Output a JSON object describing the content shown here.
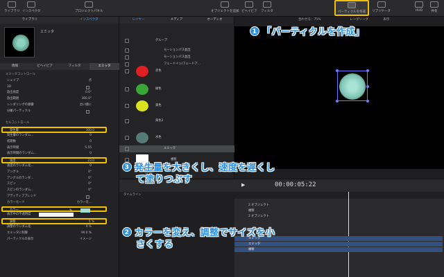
{
  "toolbar": {
    "library": "ライブラリ",
    "inspector": "インスペクタ",
    "project_panel": "プロジェクトパネル",
    "add_object": "オブジェクトを追加",
    "preview": "ビヘイビア",
    "filter": "フィルタ",
    "create_particles": "パーティクルを作成",
    "replicator": "リプリケータ",
    "hud": "HUD",
    "share": "共有"
  },
  "inspector": {
    "tabs": [
      "ライブラリ",
      "インスペクタ"
    ],
    "thumb_name": "エミッタ",
    "subtabs": [
      "情報",
      "ビヘイビア",
      "フィルタ",
      "エミッタ"
    ],
    "rows": [
      {
        "label": "エミッタコントロール",
        "type": "section"
      },
      {
        "label": "シェイプ",
        "value": "点"
      },
      {
        "label": "3D",
        "value": ""
      },
      {
        "label": "放出角度",
        "value": "0.0°"
      },
      {
        "label": "放出範囲",
        "value": "360.0°"
      },
      {
        "label": "レンダリングの順番",
        "value": "古い順に"
      },
      {
        "label": "分離パーティクル",
        "value": ""
      },
      {
        "label": "",
        "type": "spacer"
      },
      {
        "label": "セルコントロール",
        "type": "section"
      },
      {
        "label": "発生量",
        "value": "300.0",
        "hl": true
      },
      {
        "label": "発生量のランダム...",
        "value": "0"
      },
      {
        "label": "初期数",
        "value": "0"
      },
      {
        "label": "表示時間",
        "value": "5.55"
      },
      {
        "label": "表示時間のランダム...",
        "value": "0"
      },
      {
        "label": "速度",
        "value": "23.0",
        "hl": true
      },
      {
        "label": "速度のランダム化...",
        "value": "0"
      },
      {
        "label": "アングル",
        "value": "0°"
      },
      {
        "label": "アングルのランダ...",
        "value": "0°"
      },
      {
        "label": "スピン",
        "value": "0°"
      },
      {
        "label": "スピンのランダム...",
        "value": "0°"
      },
      {
        "label": "アディティブブレンド",
        "value": ""
      },
      {
        "label": "カラーモード",
        "value": "カラーを..."
      },
      {
        "label": "カラー",
        "value": "",
        "hl": true,
        "swatch": true
      },
      {
        "label": "表示中の不透明度",
        "value": "",
        "white": true
      },
      {
        "label": "調整",
        "value": "5 %",
        "hl": true
      },
      {
        "label": "調整のランダム化",
        "value": "0 %"
      },
      {
        "label": "エミッタに制御",
        "value": "90.0 %"
      },
      {
        "label": "パーティクルの表示",
        "value": "イメージ"
      }
    ]
  },
  "layers": {
    "tabs": [
      "レイヤー",
      "メディア",
      "オーディオ"
    ],
    "items": [
      {
        "name": "グループ"
      },
      {
        "name": "モーションパス並出"
      },
      {
        "name": "モーションパス並出"
      },
      {
        "name": "フェードイン/フェードア..."
      },
      {
        "name": "赤色"
      },
      {
        "name": "緑色"
      },
      {
        "name": "黄色"
      },
      {
        "name": "黄色2"
      },
      {
        "name": "水色"
      },
      {
        "name": "エミッタ"
      },
      {
        "name": "複製"
      }
    ]
  },
  "canvas": {
    "zoom_label": "合わせる：75%",
    "render": "レンダリング",
    "view": "表示",
    "timecode": "00:00:05:22"
  },
  "timeline": {
    "header": "タイムライン",
    "tracks": [
      {
        "label": "2 オブジェクト",
        "style": "dark"
      },
      {
        "label": "複製",
        "style": "dark"
      },
      {
        "label": "2 オブジェクト",
        "style": "dark"
      },
      {
        "label": "赤色",
        "style": "dark"
      },
      {
        "label": "エミッタ",
        "style": "blue"
      },
      {
        "label": "エミッタ",
        "style": "blue"
      },
      {
        "label": "複製",
        "style": "blue"
      }
    ]
  },
  "annotations": {
    "a1_num": "1",
    "a1_text": "「パーティクルを作成」",
    "a2_num": "2",
    "a2_line1": "カラーを変え、調整でサイズを小",
    "a2_line2": "さくする",
    "a3_num": "3",
    "a3_line1": "発生量を大きくし、速度を遅くし",
    "a3_line2": "て塗りつぶす"
  },
  "colors": {
    "accent": "#2f8fe0",
    "highlight": "#f2c200",
    "particle": "#9fe0d8"
  }
}
